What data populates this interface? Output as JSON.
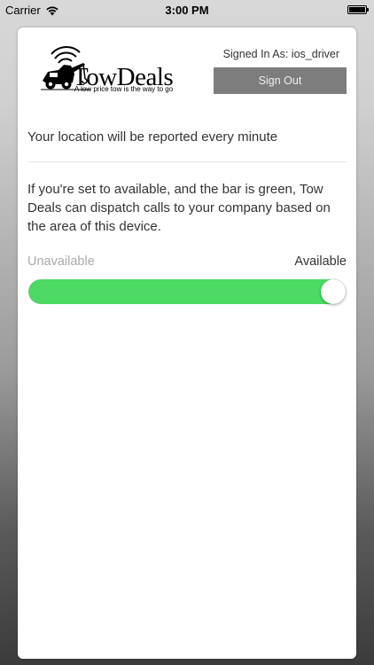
{
  "status_bar": {
    "carrier": "Carrier",
    "time": "3:00 PM",
    "wifi_icon": "wifi-icon",
    "battery_icon": "battery-icon",
    "battery_level": 1.0
  },
  "header": {
    "logo_title": "TowDeals",
    "logo_tagline": "A low price tow is the way to go",
    "logo_icon": "tow-truck-icon",
    "signed_in_text": "Signed In As: ios_driver",
    "sign_out_label": "Sign Out"
  },
  "main": {
    "location_text": "Your location will be reported every  minute",
    "info_text": "If you're set to available, and the bar is green, Tow Deals can dispatch calls to your company based on the area of this device.",
    "availability": {
      "unavailable_label": "Unavailable",
      "available_label": "Available",
      "value": 1.0,
      "is_available": true
    }
  },
  "colors": {
    "toggle_on": "#4cd964",
    "sign_out_bg": "#7d7d7d",
    "card_bg": "#ffffff"
  }
}
